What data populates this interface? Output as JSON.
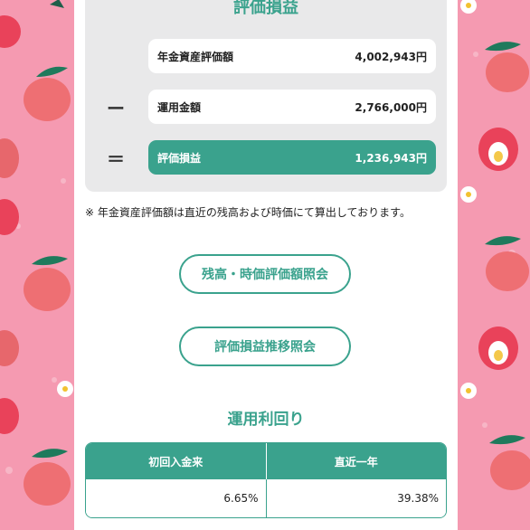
{
  "valuation": {
    "title": "評価損益",
    "rows": [
      {
        "label": "年金資産評価額",
        "value": "4,002,943円"
      },
      {
        "label": "運用金額",
        "value": "2,766,000円"
      },
      {
        "label": "評価損益",
        "value": "1,236,943円"
      }
    ],
    "minus": "ー",
    "equals": "＝"
  },
  "note": "※ 年金資産評価額は直近の残高および時価にて算出しております。",
  "buttons": {
    "balance": "残高・時価評価額照会",
    "trend": "評価損益推移照会"
  },
  "returns": {
    "title": "運用利回り",
    "headers": [
      "初回入金来",
      "直近一年"
    ],
    "values": [
      "6.65%",
      "39.38%"
    ]
  },
  "colors": {
    "accent": "#3aa28d",
    "background_pattern": "#f59ab1"
  }
}
